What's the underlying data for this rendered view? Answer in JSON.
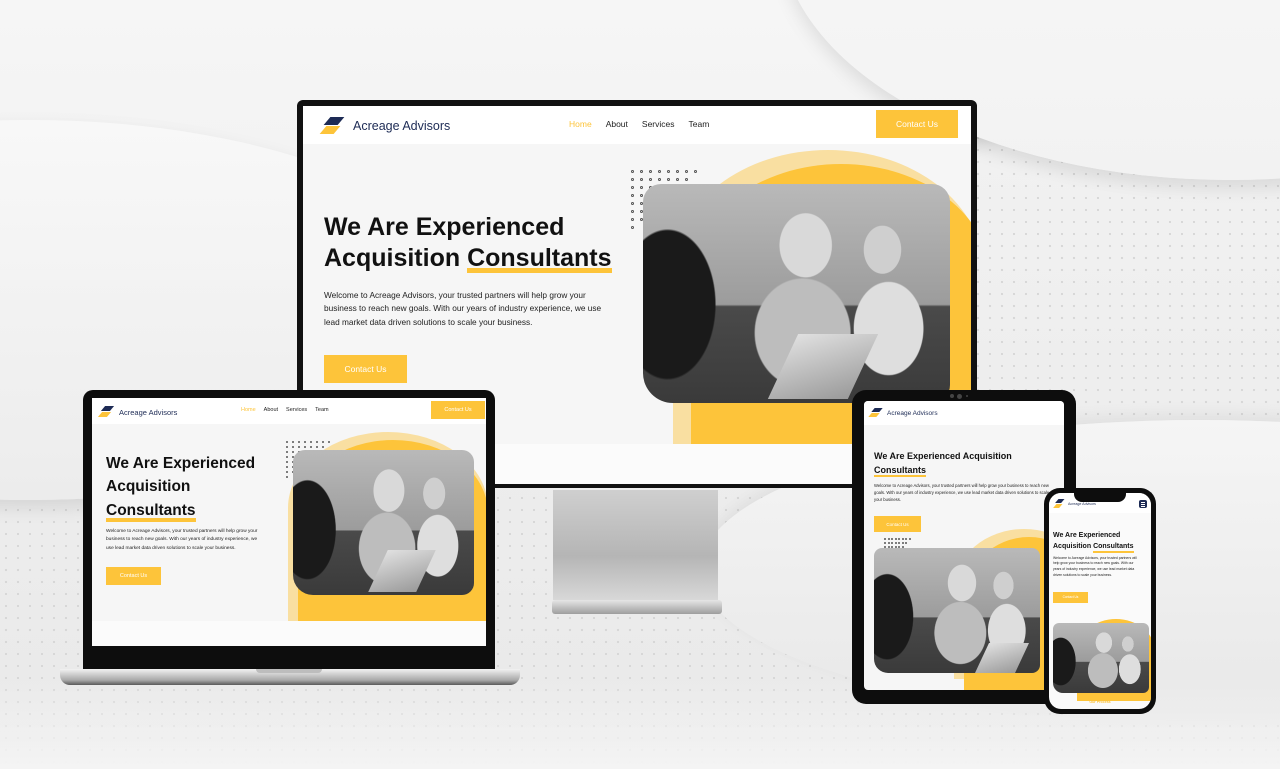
{
  "brand": {
    "name": "Acreage Advisors",
    "accent_color": "#fdc43a",
    "navy_color": "#1d2b55",
    "logo_icon": "stacked-parallelogram-logo-icon"
  },
  "nav": {
    "items": [
      {
        "label": "Home",
        "active": true
      },
      {
        "label": "About",
        "active": false
      },
      {
        "label": "Services",
        "active": false
      },
      {
        "label": "Team",
        "active": false
      }
    ],
    "cta_label": "Contact Us",
    "menu_icon": "hamburger-menu-icon"
  },
  "hero": {
    "headline_part1": "We Are Experienced",
    "headline_part2": "Acquisition",
    "headline_highlight": "Consultants",
    "headline_full_tablet": "We Are Experienced Acquisition",
    "description": "Welcome to Acreage Advisors, your trusted partners will help grow your business to reach new goals. With our years of industry experience, we use lead market data driven solutions to scale your business.",
    "cta_label": "Contact Us",
    "image_alt": "business-meeting-photo"
  },
  "phone_extra": {
    "section_label": "Our Process"
  },
  "devices": [
    "desktop-monitor",
    "laptop",
    "tablet",
    "phone"
  ]
}
